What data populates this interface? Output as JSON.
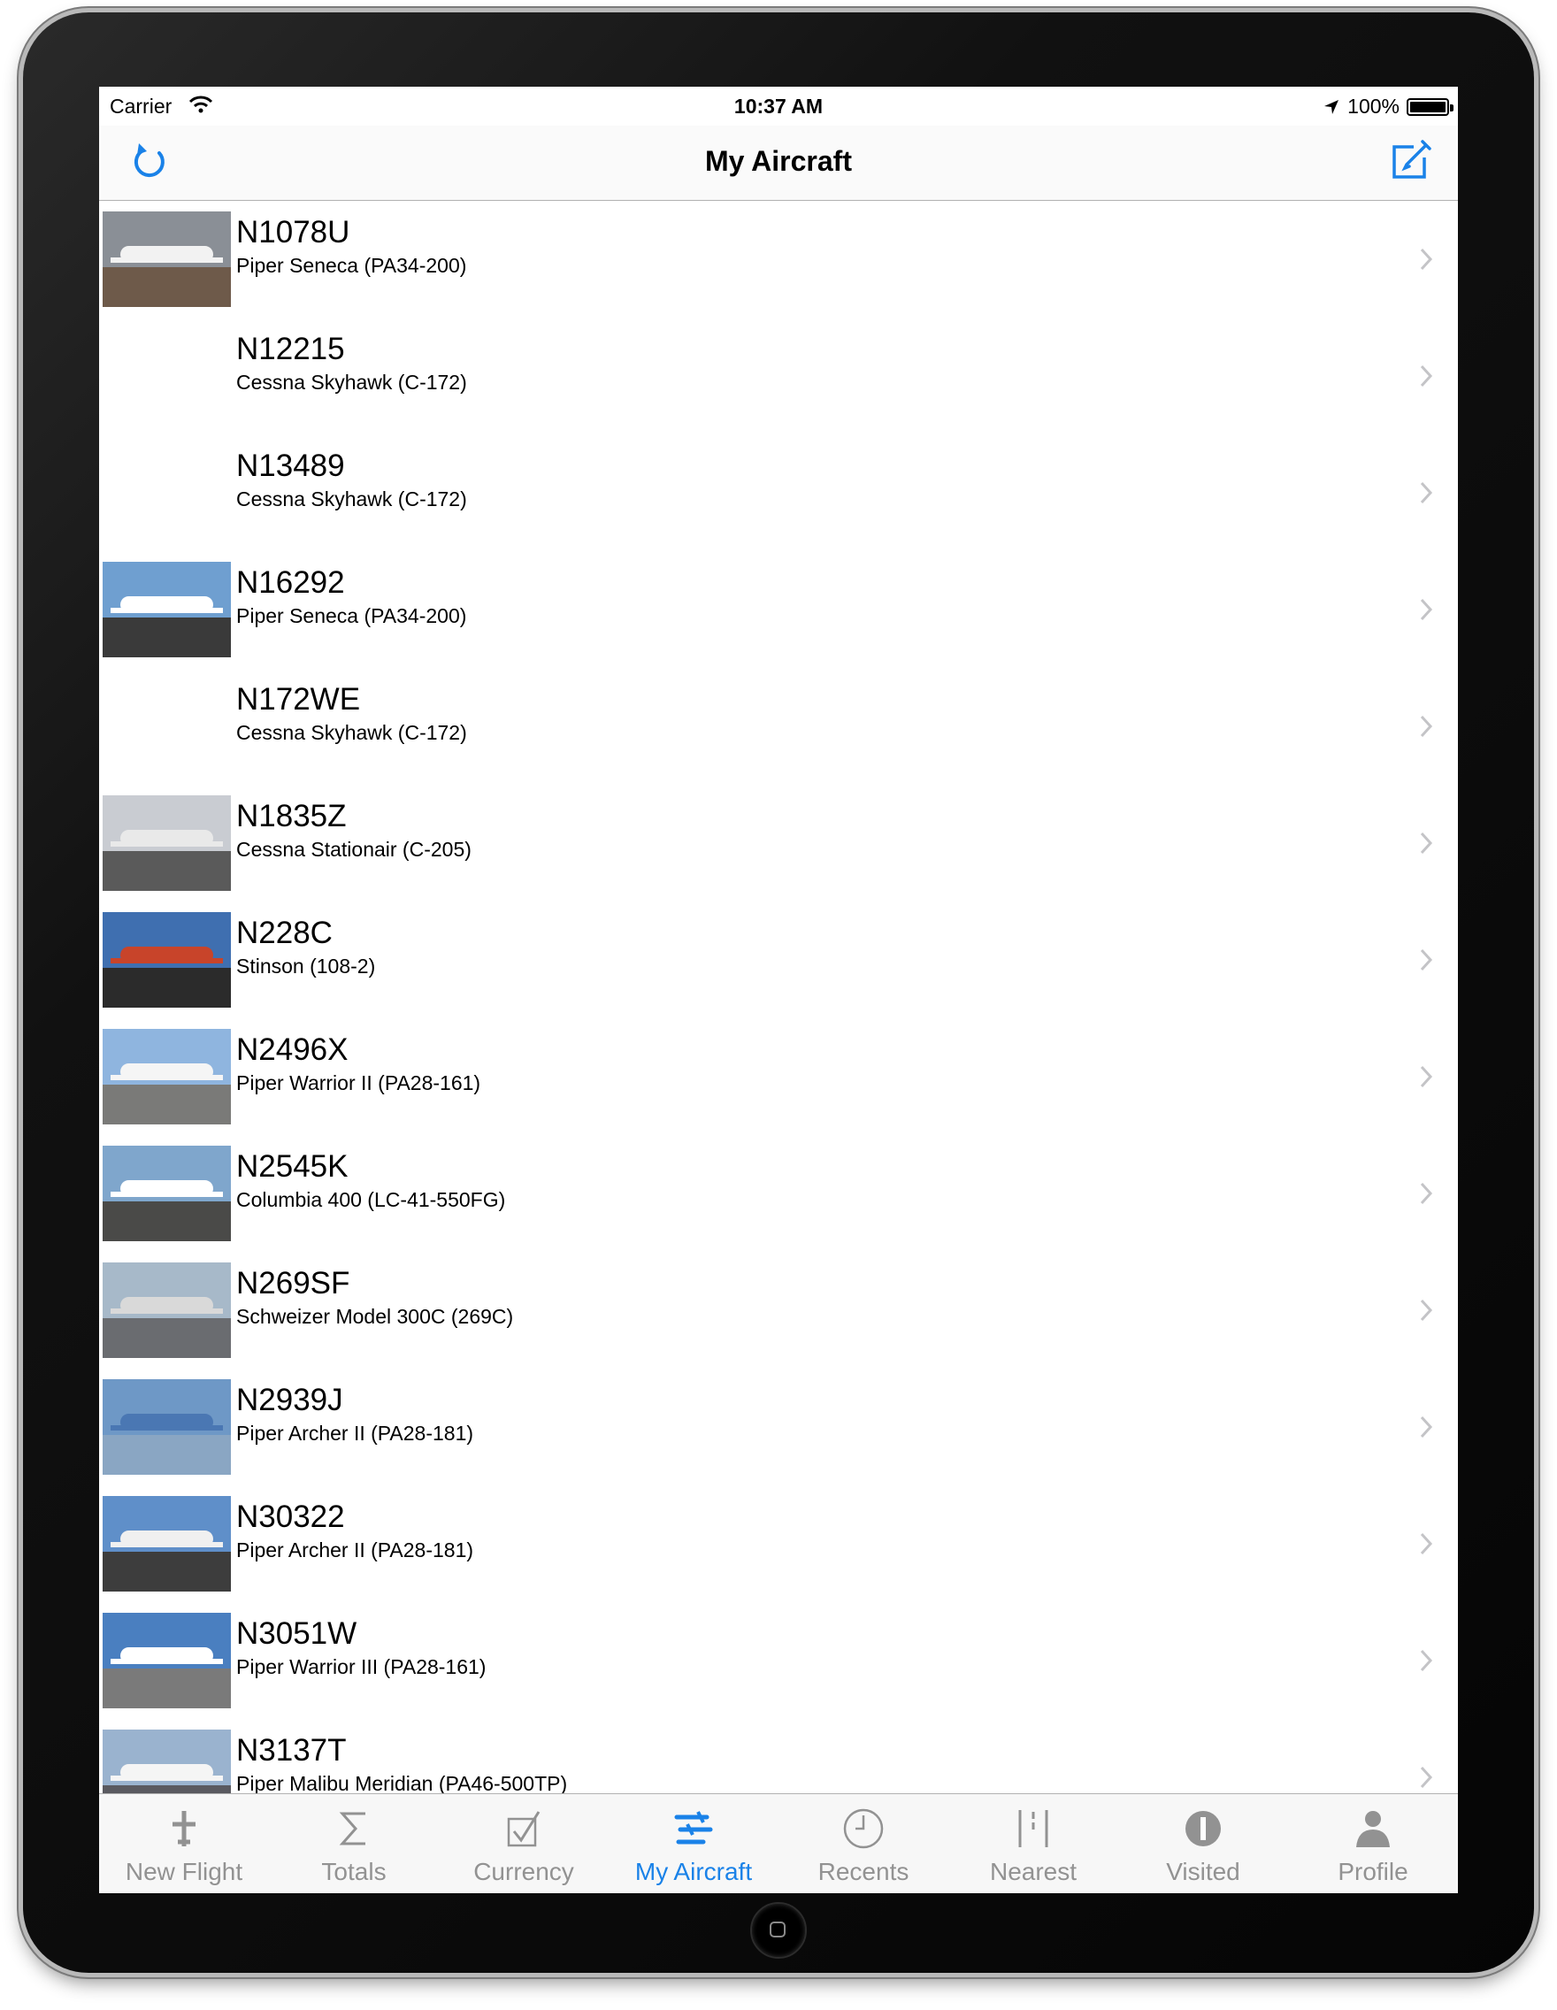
{
  "status_bar": {
    "carrier": "Carrier",
    "time": "10:37 AM",
    "battery": "100%"
  },
  "nav": {
    "title": "My Aircraft"
  },
  "aircraft": [
    {
      "reg": "N1078U",
      "model": "Piper Seneca (PA34-200)",
      "has_photo": true,
      "sky": "#8a8f96",
      "ground": "#6e5a4a",
      "body": "#f2f2f2"
    },
    {
      "reg": "N12215",
      "model": "Cessna Skyhawk (C-172)",
      "has_photo": false
    },
    {
      "reg": "N13489",
      "model": "Cessna Skyhawk (C-172)",
      "has_photo": false
    },
    {
      "reg": "N16292",
      "model": "Piper Seneca (PA34-200)",
      "has_photo": true,
      "sky": "#6f9fd0",
      "ground": "#3a3a3a",
      "body": "#ffffff"
    },
    {
      "reg": "N172WE",
      "model": "Cessna Skyhawk (C-172)",
      "has_photo": false
    },
    {
      "reg": "N1835Z",
      "model": "Cessna Stationair (C-205)",
      "has_photo": true,
      "sky": "#c9ccd2",
      "ground": "#5a5a5a",
      "body": "#e9e9e9"
    },
    {
      "reg": "N228C",
      "model": "Stinson  (108-2)",
      "has_photo": true,
      "sky": "#3f6fb0",
      "ground": "#2b2b2b",
      "body": "#c8442a"
    },
    {
      "reg": "N2496X",
      "model": "Piper Warrior II (PA28-161)",
      "has_photo": true,
      "sky": "#8fb5df",
      "ground": "#7a7a78",
      "body": "#f5f5f5"
    },
    {
      "reg": "N2545K",
      "model": "Columbia 400 (LC-41-550FG)",
      "has_photo": true,
      "sky": "#7fa6cc",
      "ground": "#4a4a48",
      "body": "#ffffff"
    },
    {
      "reg": "N269SF",
      "model": "Schweizer Model 300C (269C)",
      "has_photo": true,
      "sky": "#a7b9c9",
      "ground": "#6a6c70",
      "body": "#d9d9d9"
    },
    {
      "reg": "N2939J",
      "model": "Piper Archer II (PA28-181)",
      "has_photo": true,
      "sky": "#6e98c6",
      "ground": "#8aa6c3",
      "body": "#4a77b3"
    },
    {
      "reg": "N30322",
      "model": "Piper Archer II (PA28-181)",
      "has_photo": true,
      "sky": "#5f8fc9",
      "ground": "#3d3d3d",
      "body": "#f0f0f0"
    },
    {
      "reg": "N3051W",
      "model": "Piper Warrior III (PA28-161)",
      "has_photo": true,
      "sky": "#4a7fc0",
      "ground": "#7a7a7a",
      "body": "#ffffff"
    },
    {
      "reg": "N3137T",
      "model": "Piper Malibu Meridian (PA46-500TP)",
      "has_photo": true,
      "sky": "#9ab3cf",
      "ground": "#5a5a60",
      "body": "#f5f5f5"
    }
  ],
  "tabs": [
    {
      "label": "New Flight",
      "icon": "new-flight-icon",
      "active": false
    },
    {
      "label": "Totals",
      "icon": "sigma-icon",
      "active": false
    },
    {
      "label": "Currency",
      "icon": "checkbox-icon",
      "active": false
    },
    {
      "label": "My Aircraft",
      "icon": "aircraft-icon",
      "active": true
    },
    {
      "label": "Recents",
      "icon": "clock-icon",
      "active": false
    },
    {
      "label": "Nearest",
      "icon": "runway-icon",
      "active": false
    },
    {
      "label": "Visited",
      "icon": "info-icon",
      "active": false
    },
    {
      "label": "Profile",
      "icon": "person-icon",
      "active": false
    }
  ],
  "colors": {
    "accent": "#1a82e8",
    "inactive": "#929292"
  }
}
